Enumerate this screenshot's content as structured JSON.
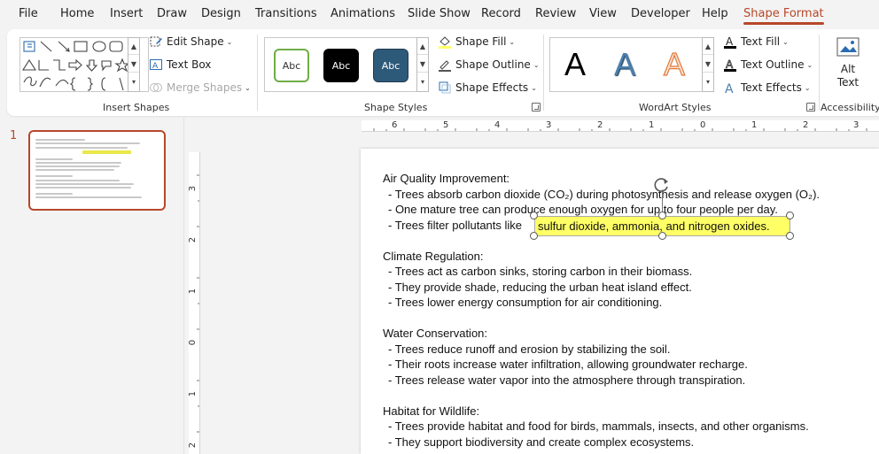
{
  "menu": {
    "tabs": [
      "File",
      "Home",
      "Insert",
      "Draw",
      "Design",
      "Transitions",
      "Animations",
      "Slide Show",
      "Record",
      "Review",
      "View",
      "Developer",
      "Help",
      "Shape Format"
    ],
    "active": "Shape Format"
  },
  "ribbon": {
    "insert_shapes": {
      "label": "Insert Shapes",
      "edit_shape": "Edit Shape",
      "text_box": "Text Box",
      "merge_shapes": "Merge Shapes"
    },
    "shape_styles": {
      "label": "Shape Styles",
      "presets": [
        "Abc",
        "Abc",
        "Abc"
      ],
      "shape_fill": "Shape Fill",
      "shape_outline": "Shape Outline",
      "shape_effects": "Shape Effects"
    },
    "wordart_styles": {
      "label": "WordArt Styles",
      "presets": [
        "A",
        "A",
        "A"
      ],
      "text_fill": "Text Fill",
      "text_outline": "Text Outline",
      "text_effects": "Text Effects"
    },
    "accessibility": {
      "label": "Accessibility",
      "alt_text": "Alt Text"
    }
  },
  "thumbnails": {
    "slide_number": "1"
  },
  "rulers": {
    "horizontal": [
      "6",
      "5",
      "4",
      "3",
      "2",
      "1",
      "0",
      "1",
      "2",
      "3"
    ],
    "vertical": [
      "3",
      "2",
      "1",
      "0",
      "1",
      "2"
    ]
  },
  "slide": {
    "sections": [
      {
        "heading": "Air Quality Improvement:",
        "bullets": [
          "- Trees absorb carbon dioxide (CO₂) during photosynthesis and release oxygen (O₂).",
          "- One mature tree can produce enough oxygen for up to four people per day.",
          "- Trees filter pollutants like"
        ]
      },
      {
        "heading": "Climate Regulation:",
        "bullets": [
          "- Trees act as carbon sinks, storing carbon in their biomass.",
          "- They provide shade, reducing the urban heat island effect.",
          "- Trees lower energy consumption for air conditioning."
        ]
      },
      {
        "heading": "Water Conservation:",
        "bullets": [
          "- Trees reduce runoff and erosion by stabilizing the soil.",
          "- Their roots increase water infiltration, allowing groundwater recharge.",
          "- Trees release water vapor into the atmosphere through transpiration."
        ]
      },
      {
        "heading": "Habitat for Wildlife:",
        "bullets": [
          "- Trees provide habitat and food for birds, mammals, insects, and other organisms.",
          "- They support biodiversity and create complex ecosystems."
        ]
      }
    ],
    "selected_shape_text": "sulfur dioxide, ammonia, and nitrogen oxides."
  },
  "colors": {
    "accent": "#b7472a",
    "highlight_fill": "#ffff66",
    "preset_dark_blue": "#2e5a7a",
    "preset_green": "#70ad47"
  }
}
